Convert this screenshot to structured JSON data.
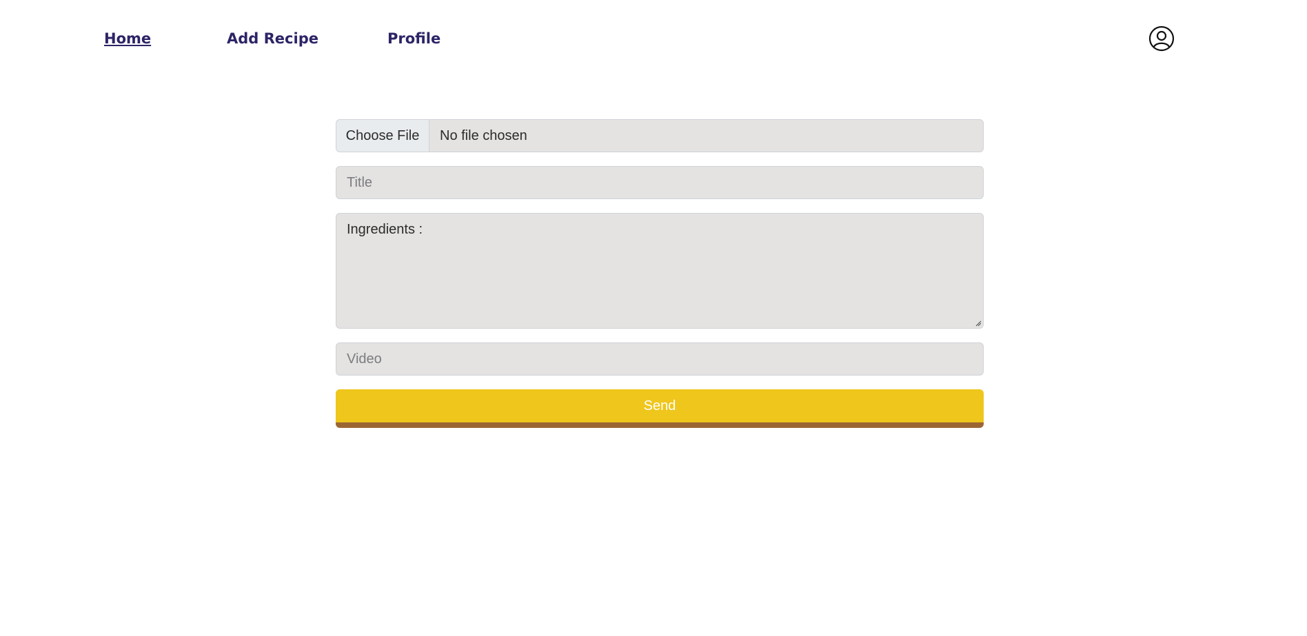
{
  "nav": {
    "home": "Home",
    "add_recipe": "Add Recipe",
    "profile": "Profile",
    "profile_icon": "user-circle-icon"
  },
  "form": {
    "file_button": "Choose File",
    "file_status": "No file chosen",
    "title_placeholder": "Title",
    "ingredients_value": "Ingredients :",
    "video_placeholder": "Video",
    "send_label": "Send"
  },
  "colors": {
    "nav_text": "#2c2466",
    "field_bg": "#e4e3e2",
    "send_bg": "#efc61c",
    "send_shadow": "#9c6633"
  }
}
